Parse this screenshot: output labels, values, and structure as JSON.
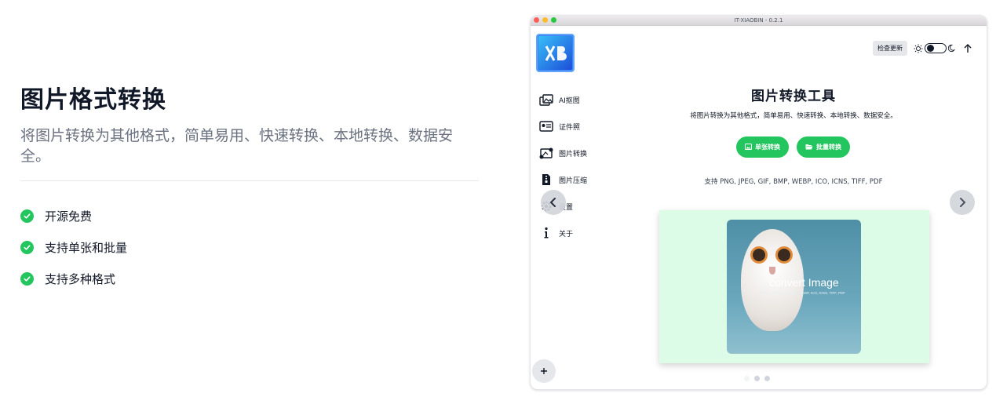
{
  "marketing": {
    "title": "图片格式转换",
    "description": "将图片转换为其他格式，简单易用、快速转换、本地转换、数据安全。",
    "features": [
      "开源免费",
      "支持单张和批量",
      "支持多种格式"
    ]
  },
  "window": {
    "title": "IT-XIAOBIN - 0.2.1",
    "topbar": {
      "update_label": "检查更新"
    },
    "sidebar": {
      "items": [
        {
          "label": "AI抠图",
          "icon": "image-cutout-icon"
        },
        {
          "label": "证件照",
          "icon": "id-card-icon"
        },
        {
          "label": "图片转换",
          "icon": "image-convert-icon"
        },
        {
          "label": "图片压缩",
          "icon": "file-zip-icon"
        },
        {
          "label": "设置",
          "icon": "gear-icon"
        },
        {
          "label": "关于",
          "icon": "info-icon"
        }
      ]
    },
    "main": {
      "title": "图片转换工具",
      "subtitle": "将图片转换为其他格式，简单易用、快速转换、本地转换、数据安全。",
      "single_label": "单张转换",
      "batch_label": "批量转换",
      "formats": "支持 PNG, JPEG, GIF, BMP, WEBP, ICO, ICNS, TIFF, PDF",
      "slide": {
        "heading": "convert Image",
        "formats": "PNG, JPEG, GIF, BMP, WEBP, ICO, ICNS, TIFF, PDF"
      }
    },
    "carousel": {
      "slide_count": 3,
      "active_index": 0
    }
  },
  "colors": {
    "accent": "#22c55e",
    "carousel_bg": "#dcfce7",
    "text_muted": "#6b7280"
  }
}
